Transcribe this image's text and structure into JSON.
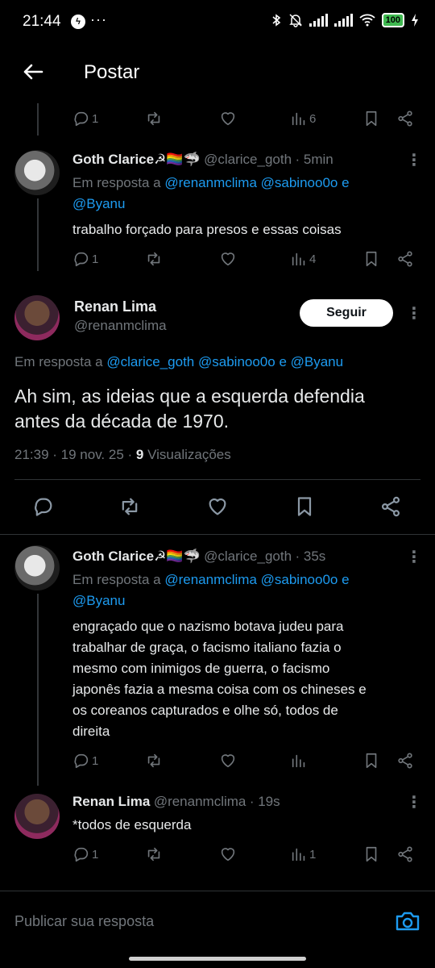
{
  "status_bar": {
    "time": "21:44",
    "dots": "···",
    "battery": "100"
  },
  "header": {
    "title": "Postar"
  },
  "tweet_top": {
    "replies": "1",
    "views": "6"
  },
  "tweet_clarice_1": {
    "name": "Goth Clarice☭🏳️‍🌈🦈",
    "handle": "@clarice_goth",
    "time": "· 5min",
    "reply_prefix": "Em resposta a ",
    "mentions": [
      "@renanmclima",
      "@sabinoo0o",
      "@Byanu"
    ],
    "conj": " e ",
    "text": "trabalho forçado para presos e essas coisas",
    "replies": "1",
    "views": "4"
  },
  "main_tweet": {
    "name": "Renan Lima",
    "handle": "@renanmclima",
    "follow_label": "Seguir",
    "reply_prefix": "Em resposta a ",
    "mentions": [
      "@clarice_goth",
      "@sabinoo0o",
      "@Byanu"
    ],
    "conj": " e ",
    "text_line1": "Ah sim, as ideias que a esquerda defendia",
    "text_line2": "antes da década de 1970.",
    "meta_time": "21:39 · 19 nov. 25 · ",
    "meta_views_count": "9",
    "meta_views_label": " Visualizações"
  },
  "tweet_clarice_2": {
    "name": "Goth Clarice☭🏳️‍🌈🦈",
    "handle": "@clarice_goth",
    "time": "· 35s",
    "reply_prefix": "Em resposta a ",
    "mentions": [
      "@renanmclima",
      "@sabinoo0o",
      "@Byanu"
    ],
    "conj": " e ",
    "lines": [
      "engraçado que o nazismo botava judeu para",
      "trabalhar de graça, o facismo italiano fazia o",
      "mesmo com inimigos de guerra, o facismo",
      "japonês fazia a mesma coisa com os chineses e",
      "os coreanos capturados e olhe só, todos de",
      "direita"
    ],
    "replies": "1"
  },
  "tweet_renan_reply": {
    "name": "Renan Lima",
    "handle": "@renanmclima",
    "time": "· 19s",
    "text": "*todos de esquerda",
    "replies": "1",
    "views": "1"
  },
  "composer": {
    "placeholder": "Publicar sua resposta"
  },
  "colors": {
    "accent": "#1d9bf0",
    "muted": "#71767b",
    "text": "#e7e9ea",
    "background": "#000000"
  }
}
